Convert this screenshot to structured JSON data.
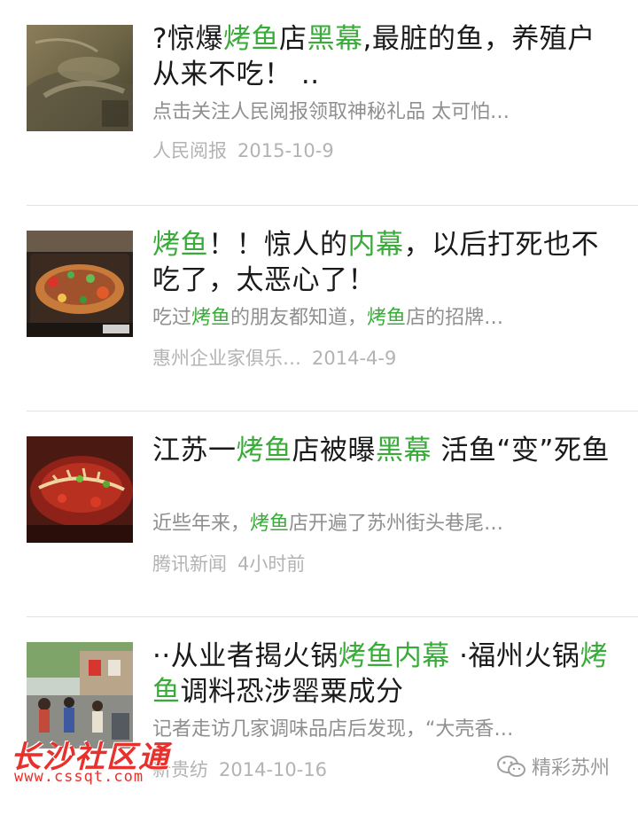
{
  "articles": [
    {
      "title_parts": [
        {
          "text": "?惊爆",
          "hl": false
        },
        {
          "text": "烤鱼",
          "hl": true
        },
        {
          "text": "店",
          "hl": false
        },
        {
          "text": "黑幕",
          "hl": true
        },
        {
          "text": ",最脏的鱼，养殖户从来不吃！ ..",
          "hl": false
        }
      ],
      "desc_parts": [
        {
          "text": "点击关注人民阅报领取神秘礼品 太可怕…",
          "hl": false
        }
      ],
      "source": "人民阅报",
      "date": "2015-10-9",
      "thumb_icon": "fish-photo-thumbnail"
    },
    {
      "title_parts": [
        {
          "text": "烤鱼",
          "hl": true
        },
        {
          "text": "！！惊人的",
          "hl": false
        },
        {
          "text": "内幕",
          "hl": true
        },
        {
          "text": "，以后打死也不吃了，太恶心了！",
          "hl": false
        }
      ],
      "desc_parts": [
        {
          "text": "吃过",
          "hl": false
        },
        {
          "text": "烤鱼",
          "hl": true
        },
        {
          "text": "的朋友都知道，",
          "hl": false
        },
        {
          "text": "烤鱼",
          "hl": true
        },
        {
          "text": "店的招牌…",
          "hl": false
        }
      ],
      "source": "惠州企业家俱乐…",
      "date": "2014-4-9",
      "thumb_icon": "grilled-fish-photo-thumbnail"
    },
    {
      "title_parts": [
        {
          "text": "江苏一",
          "hl": false
        },
        {
          "text": "烤鱼",
          "hl": true
        },
        {
          "text": "店被曝",
          "hl": false
        },
        {
          "text": "黑幕",
          "hl": true
        },
        {
          "text": " 活鱼“变”死鱼",
          "hl": false
        }
      ],
      "desc_parts": [
        {
          "text": "近些年来，",
          "hl": false
        },
        {
          "text": "烤鱼",
          "hl": true
        },
        {
          "text": "店开遍了苏州街头巷尾…",
          "hl": false
        }
      ],
      "source": "腾讯新闻",
      "date": "4小时前",
      "thumb_icon": "spicy-fish-photo-thumbnail"
    },
    {
      "title_parts": [
        {
          "text": "··从业者揭火锅",
          "hl": false
        },
        {
          "text": "烤鱼",
          "hl": true
        },
        {
          "text": "内幕",
          "hl": true
        },
        {
          "text": " ·福州火锅",
          "hl": false
        },
        {
          "text": "烤鱼",
          "hl": true
        },
        {
          "text": "调料恐涉罂粟成分",
          "hl": false
        }
      ],
      "desc_parts": [
        {
          "text": "记者走访几家调味品店后发现，“大壳香…",
          "hl": false
        }
      ],
      "source": "新贵纺",
      "date": "2014-10-16",
      "thumb_icon": "street-market-photo-thumbnail"
    }
  ],
  "watermark_left": {
    "name": "长沙社区通",
    "url": "www.cssqt.com",
    "color": "#e8312c"
  },
  "watermark_right": {
    "name": "精彩苏州",
    "icon": "wechat-icon"
  },
  "colors": {
    "highlight": "#3aab3a",
    "title": "#1a1a1a",
    "desc": "#8f8f8f",
    "meta": "#b3b3b3"
  }
}
